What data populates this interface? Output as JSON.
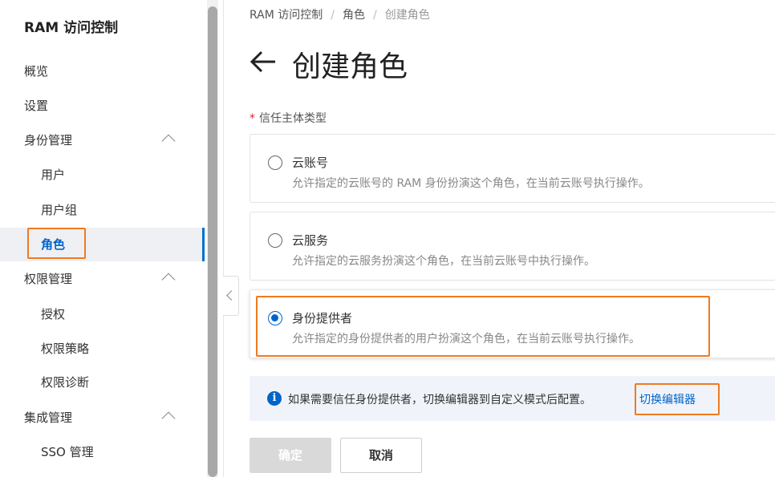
{
  "sidebar": {
    "title": "RAM 访问控制",
    "items": [
      {
        "label": "概览"
      },
      {
        "label": "设置"
      },
      {
        "label": "身份管理"
      },
      {
        "label": "用户"
      },
      {
        "label": "用户组"
      },
      {
        "label": "角色"
      },
      {
        "label": "权限管理"
      },
      {
        "label": "授权"
      },
      {
        "label": "权限策略"
      },
      {
        "label": "权限诊断"
      },
      {
        "label": "集成管理"
      },
      {
        "label": "SSO 管理"
      }
    ]
  },
  "breadcrumb": {
    "items": [
      "RAM 访问控制",
      "角色",
      "创建角色"
    ],
    "separator": "/"
  },
  "page": {
    "title": "创建角色",
    "field_label": "信任主体类型",
    "required_mark": "*"
  },
  "options": [
    {
      "title": "云账号",
      "desc": "允许指定的云账号的 RAM 身份扮演这个角色，在当前云账号执行操作。",
      "checked": false
    },
    {
      "title": "云服务",
      "desc": "允许指定的云服务扮演这个角色，在当前云账号中执行操作。",
      "checked": false
    },
    {
      "title": "身份提供者",
      "desc": "允许指定的身份提供者的用户扮演这个角色，在当前云账号执行操作。",
      "checked": true
    }
  ],
  "info": {
    "icon": "i",
    "text": "如果需要信任身份提供者，切换编辑器到自定义模式后配置。",
    "link": "切换编辑器"
  },
  "buttons": {
    "ok": "确定",
    "cancel": "取消"
  },
  "colors": {
    "accent": "#0064c8",
    "highlight": "#f07a1e",
    "required": "#e0242b"
  }
}
